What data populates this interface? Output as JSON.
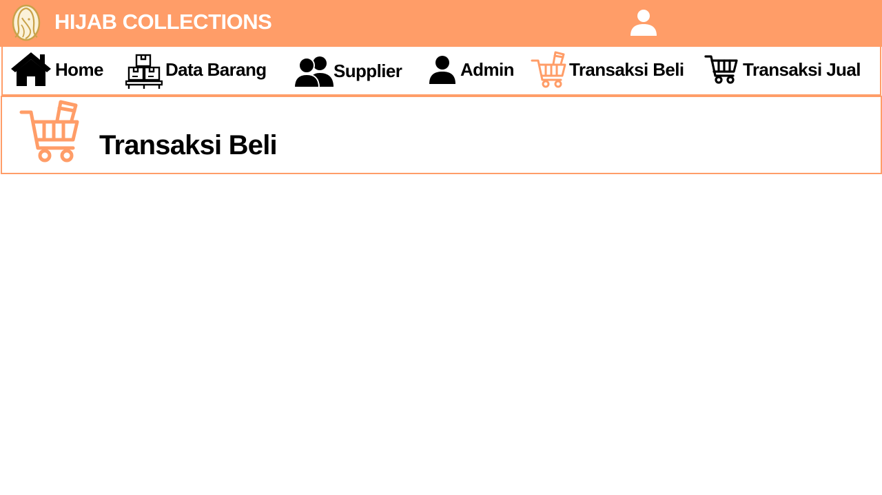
{
  "header": {
    "logo_icon": "hijab-woman-logo-icon",
    "brand": "HIJAB COLLECTIONS",
    "user_icon": "user-icon",
    "background_color": "#ff9d68"
  },
  "nav": {
    "items": [
      {
        "label": "Home",
        "icon": "house-icon",
        "active": false
      },
      {
        "label": "Data Barang",
        "icon": "boxes-pallet-icon",
        "active": false
      },
      {
        "label": "Supplier",
        "icon": "users-icon",
        "active": false
      },
      {
        "label": "Admin",
        "icon": "user-icon",
        "active": false
      },
      {
        "label": "Transaksi Beli",
        "icon": "shopping-cart-icon",
        "active": true
      },
      {
        "label": "Transaksi Jual",
        "icon": "shopping-cart-icon",
        "active": false
      }
    ],
    "active_color": "#ff9d68",
    "border_color": "#ff9d68"
  },
  "page": {
    "title": "Transaksi Beli",
    "icon": "shopping-cart-icon"
  }
}
